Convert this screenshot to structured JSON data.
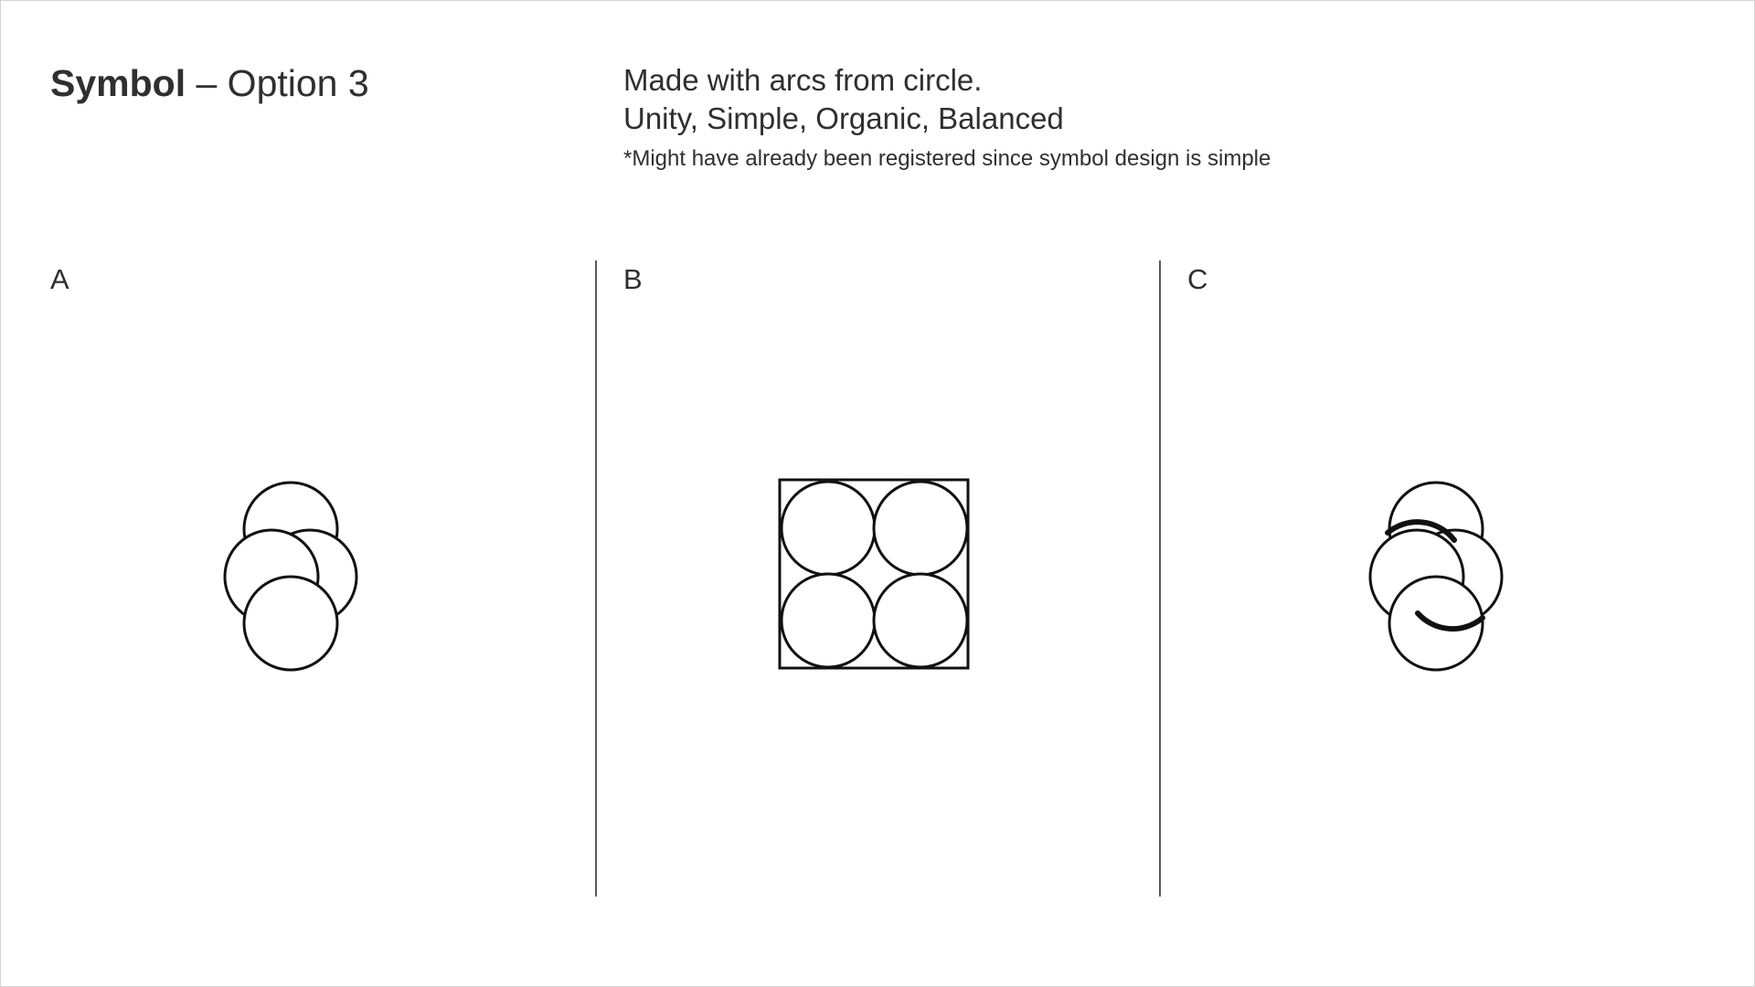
{
  "header": {
    "title_bold": "Symbol",
    "title_rest": " – Option 3"
  },
  "description": {
    "line1": "Made with arcs from circle.",
    "line2": "Unity, Simple, Organic, Balanced",
    "note": "*Might have already been registered since symbol design is simple"
  },
  "panels": [
    {
      "label": "A"
    },
    {
      "label": "B"
    },
    {
      "label": "C"
    }
  ],
  "colors": {
    "text": "#2f2f2f",
    "stroke": "#111111",
    "divider": "#5a5a5a",
    "background": "#ffffff"
  }
}
